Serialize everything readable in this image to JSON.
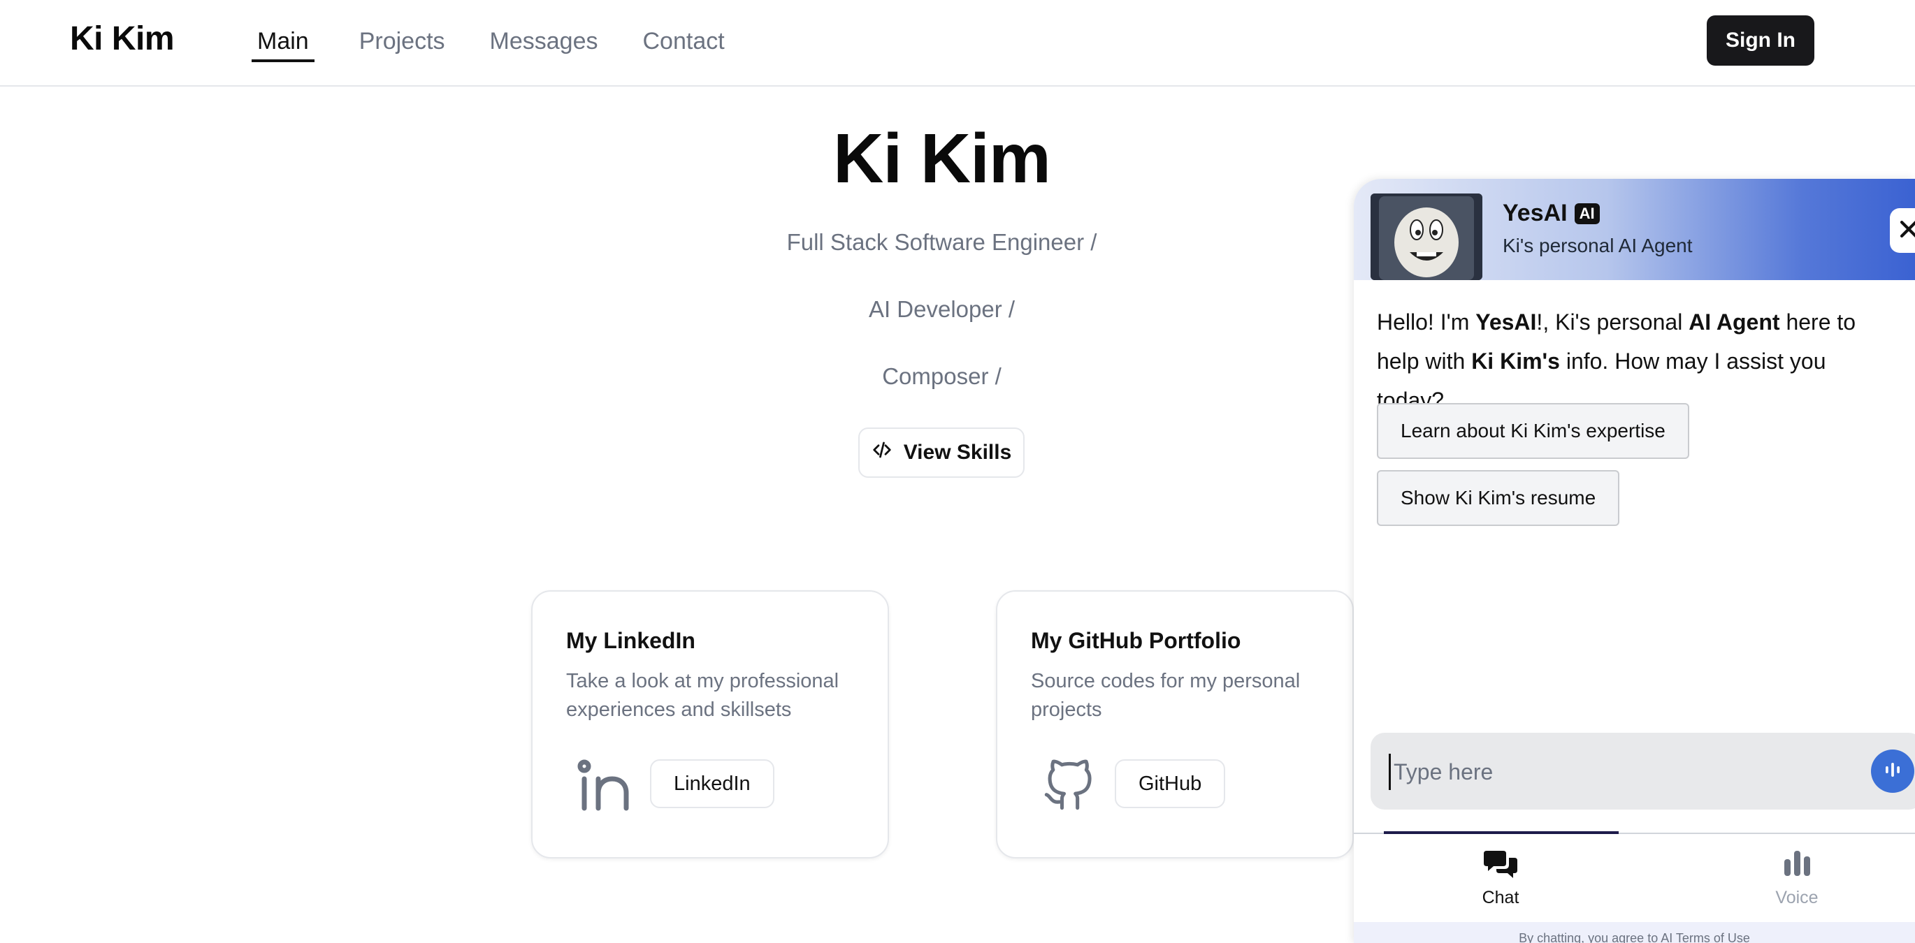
{
  "header": {
    "brand": "Ki Kim",
    "nav": [
      {
        "label": "Main",
        "active": true
      },
      {
        "label": "Projects",
        "active": false
      },
      {
        "label": "Messages",
        "active": false
      },
      {
        "label": "Contact",
        "active": false
      }
    ],
    "sign_in_label": "Sign In"
  },
  "hero": {
    "name": "Ki Kim",
    "roles": [
      "Full Stack Software Engineer /",
      "AI Developer /",
      "Composer /"
    ],
    "skills_button": {
      "label": "View Skills",
      "icon": "code-icon"
    }
  },
  "cards": [
    {
      "title": "My LinkedIn",
      "description": "Take a look at my professional experiences and skillsets",
      "icon": "linkedin-icon",
      "button_label": "LinkedIn"
    },
    {
      "title": "My GitHub Portfolio",
      "description": "Source codes for my personal projects",
      "icon": "github-icon",
      "button_label": "GitHub"
    }
  ],
  "chat": {
    "bot_name": "YesAI",
    "badge": "AI",
    "subtitle": "Ki's personal AI Agent",
    "greeting": {
      "t1": "Hello! I'm ",
      "b1": "YesAI",
      "t2": "!, Ki's personal ",
      "b2": "AI Agent",
      "t3": " here to help with ",
      "b3": "Ki Kim's",
      "t4": " info. How may I assist you today?"
    },
    "suggestions": [
      "Learn about Ki Kim's expertise",
      "Show Ki Kim's resume"
    ],
    "input_placeholder": "Type here",
    "tabs": [
      {
        "label": "Chat",
        "icon": "chat-bubbles-icon",
        "active": true
      },
      {
        "label": "Voice",
        "icon": "voice-bars-icon",
        "active": false
      }
    ],
    "footer_text": "By chatting, you agree to AI Terms of Use",
    "colors": {
      "accent": "#3b6fd6",
      "header_gradient_end": "#3b62d2"
    }
  }
}
